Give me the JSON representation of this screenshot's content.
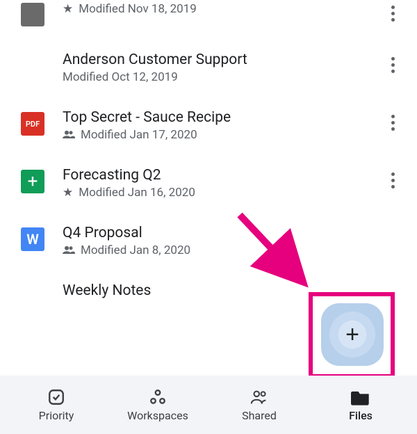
{
  "files": [
    {
      "type": "docs",
      "title": "",
      "meta_icon": "star",
      "meta_text": "Modified Nov 18, 2019"
    },
    {
      "type": "slides",
      "title": "Anderson Customer Support",
      "meta_icon": "",
      "meta_text": "Modified Oct 12, 2019"
    },
    {
      "type": "pdf",
      "title": "Top Secret - Sauce Recipe",
      "meta_icon": "shared",
      "meta_text": "Modified Jan 17, 2020"
    },
    {
      "type": "sheets",
      "title": "Forecasting Q2",
      "meta_icon": "star",
      "meta_text": "Modified Jan 16, 2020"
    },
    {
      "type": "word",
      "title": "Q4 Proposal",
      "meta_icon": "shared",
      "meta_text": "Modified Jan 8, 2020"
    },
    {
      "type": "docs",
      "title": "Weekly Notes",
      "meta_icon": "",
      "meta_text": ""
    }
  ],
  "icon_labels": {
    "pdf": "PDF",
    "word": "W",
    "sheets": "+"
  },
  "fab": {
    "glyph": "+"
  },
  "nav": {
    "items": [
      {
        "id": "priority",
        "label": "Priority"
      },
      {
        "id": "workspaces",
        "label": "Workspaces"
      },
      {
        "id": "shared",
        "label": "Shared"
      },
      {
        "id": "files",
        "label": "Files"
      }
    ],
    "active": "files"
  },
  "colors": {
    "accent": "#e6007e"
  }
}
